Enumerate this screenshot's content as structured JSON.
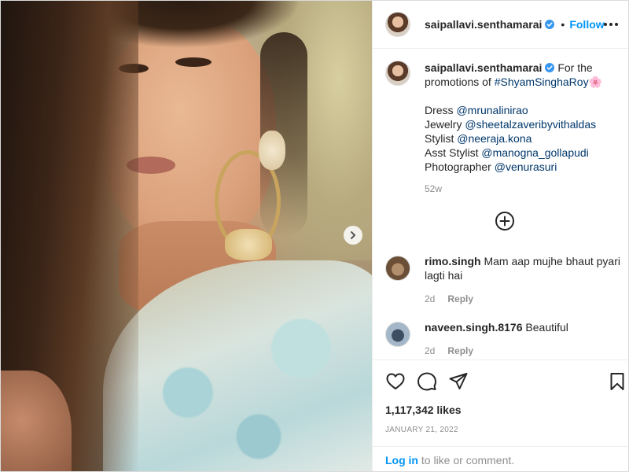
{
  "post": {
    "username": "saipallavi.senthamarai",
    "follow_label": "Follow",
    "separator": "•"
  },
  "caption": {
    "username": "saipallavi.senthamarai",
    "line1_text": "For the",
    "line2_prefix": "promotions of ",
    "hashtag": "#ShyamSinghaRoy",
    "emoji": "🌸",
    "credits": [
      {
        "label": "Dress ",
        "handle": "@mrunalinirao"
      },
      {
        "label": "Jewelry ",
        "handle": "@sheetalzaveribyvithaldas"
      },
      {
        "label": "Stylist ",
        "handle": "@neeraja.kona"
      },
      {
        "label": "Asst Stylist ",
        "handle": "@manogna_gollapudi"
      },
      {
        "label": "Photographer ",
        "handle": "@venurasuri"
      }
    ],
    "age": "52w"
  },
  "comments": [
    {
      "username": "rimo.singh",
      "text": "Mam aap mujhe bhaut pyari lagti hai",
      "age": "2d",
      "reply_label": "Reply"
    },
    {
      "username": "naveen.singh.8176",
      "text": "Beautiful",
      "age": "2d",
      "reply_label": "Reply"
    }
  ],
  "stats": {
    "likes": "1,117,342 likes",
    "date": "JANUARY 21, 2022"
  },
  "footer": {
    "login_label": "Log in",
    "suffix": " to like or comment."
  },
  "icons": {
    "verified": "verified-badge-icon",
    "more": "more-options-icon",
    "next": "chevron-right-icon",
    "load_more": "plus-circle-icon",
    "like": "heart-icon",
    "comment": "comment-icon",
    "share": "paper-plane-icon",
    "save": "bookmark-icon"
  },
  "colors": {
    "link_blue": "#0095f6",
    "mention": "#00376b",
    "muted": "#8e8e8e",
    "text": "#262626",
    "verified_blue": "#3897f0"
  }
}
